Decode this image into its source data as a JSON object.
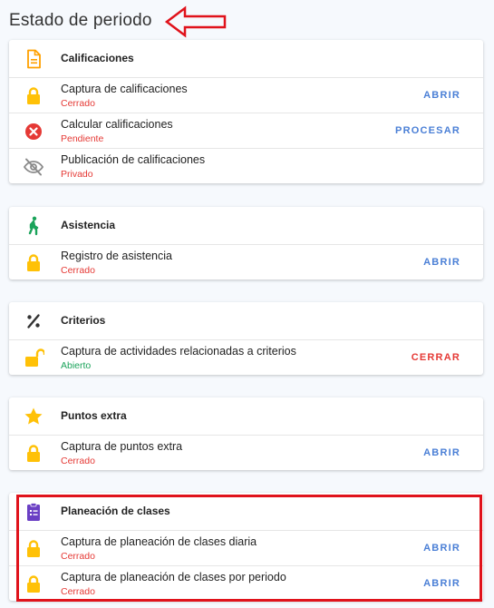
{
  "page": {
    "title": "Estado de periodo"
  },
  "colors": {
    "closed": "#e53935",
    "pending": "#e53935",
    "private": "#e53935",
    "open": "#1aa35a",
    "action_blue": "#4a7fd6",
    "action_red": "#e53935",
    "lock": "#ffc107"
  },
  "sections": [
    {
      "title": "Calificaciones",
      "icon": "document-icon",
      "rows": [
        {
          "label": "Captura de calificaciones",
          "status": "Cerrado",
          "action": "ABRIR",
          "icon": "lock-icon"
        },
        {
          "label": "Calcular calificaciones",
          "status": "Pendiente",
          "action": "PROCESAR",
          "icon": "error-icon"
        },
        {
          "label": "Publicación de calificaciones",
          "status": "Privado",
          "action": "",
          "icon": "eye-off-icon"
        }
      ]
    },
    {
      "title": "Asistencia",
      "icon": "walking-icon",
      "rows": [
        {
          "label": "Registro de asistencia",
          "status": "Cerrado",
          "action": "ABRIR",
          "icon": "lock-icon"
        }
      ]
    },
    {
      "title": "Criterios",
      "icon": "percent-icon",
      "rows": [
        {
          "label": "Captura de actividades relacionadas a criterios",
          "status": "Abierto",
          "action": "CERRAR",
          "icon": "lock-open-icon"
        }
      ]
    },
    {
      "title": "Puntos extra",
      "icon": "star-icon",
      "rows": [
        {
          "label": "Captura de puntos extra",
          "status": "Cerrado",
          "action": "ABRIR",
          "icon": "lock-icon"
        }
      ]
    },
    {
      "title": "Planeación de clases",
      "icon": "clipboard-icon",
      "rows": [
        {
          "label": "Captura de planeación de clases diaria",
          "status": "Cerrado",
          "action": "ABRIR",
          "icon": "lock-icon"
        },
        {
          "label": "Captura de planeación de clases por periodo",
          "status": "Cerrado",
          "action": "ABRIR",
          "icon": "lock-icon"
        }
      ]
    }
  ]
}
